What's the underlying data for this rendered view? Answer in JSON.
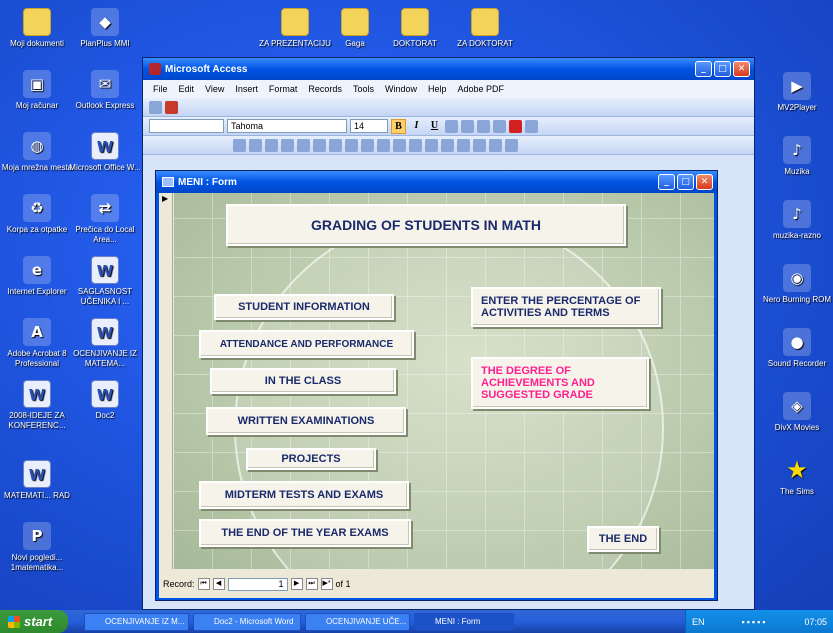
{
  "desktop": {
    "left_icons": [
      {
        "label": "Moji dokumenti",
        "icon": "folder-icon"
      },
      {
        "label": "PlanPlus MMI",
        "icon": "app-icon"
      },
      {
        "label": "Moj računar",
        "icon": "computer-icon"
      },
      {
        "label": "Outlook Express",
        "icon": "outlook-icon"
      },
      {
        "label": "Moja mrežna mesta",
        "icon": "network-icon"
      },
      {
        "label": "Microsoft Office W...",
        "icon": "word-icon"
      },
      {
        "label": "Korpa za otpatke",
        "icon": "recycle-bin-icon"
      },
      {
        "label": "Prečica do Local Area...",
        "icon": "shortcut-icon"
      },
      {
        "label": "Internet Explorer",
        "icon": "ie-icon"
      },
      {
        "label": "SAGLASNOST UČENIKA I ...",
        "icon": "doc-icon"
      },
      {
        "label": "Adobe Acrobat 8 Professional",
        "icon": "acrobat-icon"
      },
      {
        "label": "OCENJIVANJE IZ MATEMA...",
        "icon": "doc-icon"
      },
      {
        "label": "2008-IDEJE ZA KONFERENC...",
        "icon": "doc-icon"
      },
      {
        "label": "Doc2",
        "icon": "doc-icon"
      },
      {
        "label": "MATEMATI... RAD",
        "icon": "doc-icon"
      },
      {
        "label": "Novi pogledi... 1matematika...",
        "icon": "pdf-icon"
      }
    ],
    "top_icons": [
      {
        "label": "ZA PREZENTACIJU",
        "icon": "folder-icon"
      },
      {
        "label": "Gaga",
        "icon": "folder-icon"
      },
      {
        "label": "DOKTORAT",
        "icon": "folder-icon"
      },
      {
        "label": "ZA DOKTORAT",
        "icon": "folder-icon"
      }
    ],
    "right_icons": [
      {
        "label": "MV2Player",
        "icon": "player-icon"
      },
      {
        "label": "Muzika",
        "icon": "music-icon"
      },
      {
        "label": "muzika-razno",
        "icon": "music-icon"
      },
      {
        "label": "Nero Burning ROM",
        "icon": "nero-icon"
      },
      {
        "label": "Sound Recorder",
        "icon": "microphone-icon"
      },
      {
        "label": "DivX Movies",
        "icon": "divx-icon"
      },
      {
        "label": "The Sims",
        "icon": "star-icon"
      }
    ]
  },
  "access": {
    "title": "Microsoft Access",
    "menu": [
      "File",
      "Edit",
      "View",
      "Insert",
      "Format",
      "Records",
      "Tools",
      "Window",
      "Help",
      "Adobe PDF"
    ],
    "font_name": "Tahoma",
    "font_size": "14",
    "format_buttons": [
      "B",
      "I",
      "U"
    ]
  },
  "form": {
    "title": "MENI : Form",
    "heading": "GRADING OF STUDENTS IN MATH",
    "left_buttons": [
      "STUDENT INFORMATION",
      "ATTENDANCE AND PERFORMANCE",
      "IN THE CLASS",
      "WRITTEN EXAMINATIONS",
      "PROJECTS",
      "MIDTERM TESTS AND EXAMS",
      "THE END OF THE YEAR EXAMS"
    ],
    "right_buttons": [
      "ENTER THE PERCENTAGE OF ACTIVITIES AND TERMS",
      "THE DEGREE OF ACHIEVEMENTS AND SUGGESTED GRADE"
    ],
    "end_button": "THE END",
    "record": {
      "label": "Record:",
      "current": "1",
      "of": "of 1"
    }
  },
  "taskbar": {
    "start": "start",
    "tasks": [
      "OCENJIVANJE IZ M...",
      "Doc2 - Microsoft Word",
      "OCENJIVANJE UČE...",
      "MENI : Form"
    ],
    "language": "EN",
    "clock": "07:05"
  }
}
